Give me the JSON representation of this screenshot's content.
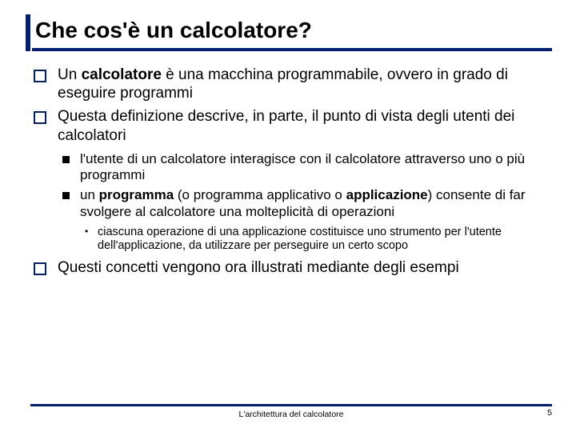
{
  "title": "Che cos'è un calcolatore?",
  "bullets": {
    "b1_pre": "Un ",
    "b1_bold": "calcolatore",
    "b1_post": " è una macchina programmabile, ovvero in grado di eseguire programmi",
    "b2": "Questa definizione descrive, in parte, il punto di vista degli utenti dei calcolatori",
    "b2a": "l'utente di un calcolatore interagisce con il calcolatore attraverso uno o più programmi",
    "b2b_pre": "un ",
    "b2b_bold1": "programma",
    "b2b_mid": " (o programma applicativo o ",
    "b2b_bold2": "applicazione",
    "b2b_post": ") consente di far svolgere al calcolatore una molteplicità di operazioni",
    "b2b_i": "ciascuna operazione di una applicazione costituisce uno strumento per l'utente dell'applicazione, da utilizzare per perseguire un certo scopo",
    "b3": "Questi concetti vengono ora illustrati mediante degli esempi"
  },
  "footer": "L'architettura del calcolatore",
  "page": "5"
}
